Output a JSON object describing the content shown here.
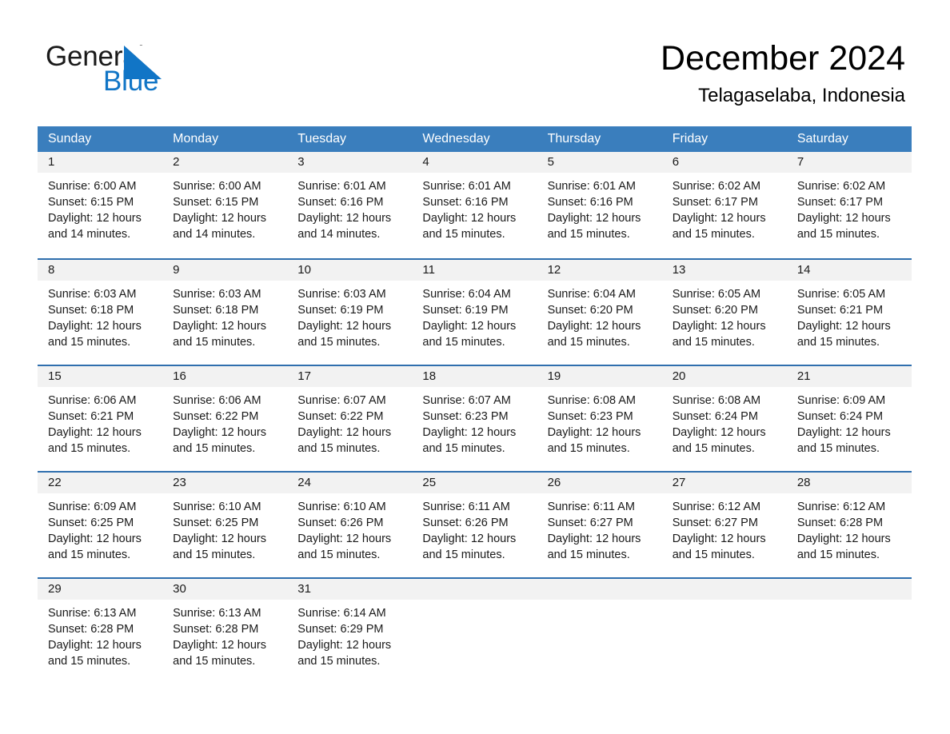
{
  "brand": {
    "name_part1": "General",
    "name_part2": "Blue",
    "triangle_icon": "triangle-logo-icon",
    "blue": "#1175c6"
  },
  "header": {
    "title": "December 2024",
    "location": "Telagaselaba, Indonesia"
  },
  "calendar": {
    "header_bg": "#3a7ebd",
    "row_divider": "#2f6fae",
    "day_band_bg": "#f2f2f2",
    "weekday_headers": [
      "Sunday",
      "Monday",
      "Tuesday",
      "Wednesday",
      "Thursday",
      "Friday",
      "Saturday"
    ],
    "weeks": [
      [
        {
          "day": "1",
          "sunrise": "Sunrise: 6:00 AM",
          "sunset": "Sunset: 6:15 PM",
          "daylight": "Daylight: 12 hours and 14 minutes."
        },
        {
          "day": "2",
          "sunrise": "Sunrise: 6:00 AM",
          "sunset": "Sunset: 6:15 PM",
          "daylight": "Daylight: 12 hours and 14 minutes."
        },
        {
          "day": "3",
          "sunrise": "Sunrise: 6:01 AM",
          "sunset": "Sunset: 6:16 PM",
          "daylight": "Daylight: 12 hours and 14 minutes."
        },
        {
          "day": "4",
          "sunrise": "Sunrise: 6:01 AM",
          "sunset": "Sunset: 6:16 PM",
          "daylight": "Daylight: 12 hours and 15 minutes."
        },
        {
          "day": "5",
          "sunrise": "Sunrise: 6:01 AM",
          "sunset": "Sunset: 6:16 PM",
          "daylight": "Daylight: 12 hours and 15 minutes."
        },
        {
          "day": "6",
          "sunrise": "Sunrise: 6:02 AM",
          "sunset": "Sunset: 6:17 PM",
          "daylight": "Daylight: 12 hours and 15 minutes."
        },
        {
          "day": "7",
          "sunrise": "Sunrise: 6:02 AM",
          "sunset": "Sunset: 6:17 PM",
          "daylight": "Daylight: 12 hours and 15 minutes."
        }
      ],
      [
        {
          "day": "8",
          "sunrise": "Sunrise: 6:03 AM",
          "sunset": "Sunset: 6:18 PM",
          "daylight": "Daylight: 12 hours and 15 minutes."
        },
        {
          "day": "9",
          "sunrise": "Sunrise: 6:03 AM",
          "sunset": "Sunset: 6:18 PM",
          "daylight": "Daylight: 12 hours and 15 minutes."
        },
        {
          "day": "10",
          "sunrise": "Sunrise: 6:03 AM",
          "sunset": "Sunset: 6:19 PM",
          "daylight": "Daylight: 12 hours and 15 minutes."
        },
        {
          "day": "11",
          "sunrise": "Sunrise: 6:04 AM",
          "sunset": "Sunset: 6:19 PM",
          "daylight": "Daylight: 12 hours and 15 minutes."
        },
        {
          "day": "12",
          "sunrise": "Sunrise: 6:04 AM",
          "sunset": "Sunset: 6:20 PM",
          "daylight": "Daylight: 12 hours and 15 minutes."
        },
        {
          "day": "13",
          "sunrise": "Sunrise: 6:05 AM",
          "sunset": "Sunset: 6:20 PM",
          "daylight": "Daylight: 12 hours and 15 minutes."
        },
        {
          "day": "14",
          "sunrise": "Sunrise: 6:05 AM",
          "sunset": "Sunset: 6:21 PM",
          "daylight": "Daylight: 12 hours and 15 minutes."
        }
      ],
      [
        {
          "day": "15",
          "sunrise": "Sunrise: 6:06 AM",
          "sunset": "Sunset: 6:21 PM",
          "daylight": "Daylight: 12 hours and 15 minutes."
        },
        {
          "day": "16",
          "sunrise": "Sunrise: 6:06 AM",
          "sunset": "Sunset: 6:22 PM",
          "daylight": "Daylight: 12 hours and 15 minutes."
        },
        {
          "day": "17",
          "sunrise": "Sunrise: 6:07 AM",
          "sunset": "Sunset: 6:22 PM",
          "daylight": "Daylight: 12 hours and 15 minutes."
        },
        {
          "day": "18",
          "sunrise": "Sunrise: 6:07 AM",
          "sunset": "Sunset: 6:23 PM",
          "daylight": "Daylight: 12 hours and 15 minutes."
        },
        {
          "day": "19",
          "sunrise": "Sunrise: 6:08 AM",
          "sunset": "Sunset: 6:23 PM",
          "daylight": "Daylight: 12 hours and 15 minutes."
        },
        {
          "day": "20",
          "sunrise": "Sunrise: 6:08 AM",
          "sunset": "Sunset: 6:24 PM",
          "daylight": "Daylight: 12 hours and 15 minutes."
        },
        {
          "day": "21",
          "sunrise": "Sunrise: 6:09 AM",
          "sunset": "Sunset: 6:24 PM",
          "daylight": "Daylight: 12 hours and 15 minutes."
        }
      ],
      [
        {
          "day": "22",
          "sunrise": "Sunrise: 6:09 AM",
          "sunset": "Sunset: 6:25 PM",
          "daylight": "Daylight: 12 hours and 15 minutes."
        },
        {
          "day": "23",
          "sunrise": "Sunrise: 6:10 AM",
          "sunset": "Sunset: 6:25 PM",
          "daylight": "Daylight: 12 hours and 15 minutes."
        },
        {
          "day": "24",
          "sunrise": "Sunrise: 6:10 AM",
          "sunset": "Sunset: 6:26 PM",
          "daylight": "Daylight: 12 hours and 15 minutes."
        },
        {
          "day": "25",
          "sunrise": "Sunrise: 6:11 AM",
          "sunset": "Sunset: 6:26 PM",
          "daylight": "Daylight: 12 hours and 15 minutes."
        },
        {
          "day": "26",
          "sunrise": "Sunrise: 6:11 AM",
          "sunset": "Sunset: 6:27 PM",
          "daylight": "Daylight: 12 hours and 15 minutes."
        },
        {
          "day": "27",
          "sunrise": "Sunrise: 6:12 AM",
          "sunset": "Sunset: 6:27 PM",
          "daylight": "Daylight: 12 hours and 15 minutes."
        },
        {
          "day": "28",
          "sunrise": "Sunrise: 6:12 AM",
          "sunset": "Sunset: 6:28 PM",
          "daylight": "Daylight: 12 hours and 15 minutes."
        }
      ],
      [
        {
          "day": "29",
          "sunrise": "Sunrise: 6:13 AM",
          "sunset": "Sunset: 6:28 PM",
          "daylight": "Daylight: 12 hours and 15 minutes."
        },
        {
          "day": "30",
          "sunrise": "Sunrise: 6:13 AM",
          "sunset": "Sunset: 6:28 PM",
          "daylight": "Daylight: 12 hours and 15 minutes."
        },
        {
          "day": "31",
          "sunrise": "Sunrise: 6:14 AM",
          "sunset": "Sunset: 6:29 PM",
          "daylight": "Daylight: 12 hours and 15 minutes."
        },
        {
          "day": "",
          "sunrise": "",
          "sunset": "",
          "daylight": ""
        },
        {
          "day": "",
          "sunrise": "",
          "sunset": "",
          "daylight": ""
        },
        {
          "day": "",
          "sunrise": "",
          "sunset": "",
          "daylight": ""
        },
        {
          "day": "",
          "sunrise": "",
          "sunset": "",
          "daylight": ""
        }
      ]
    ]
  }
}
